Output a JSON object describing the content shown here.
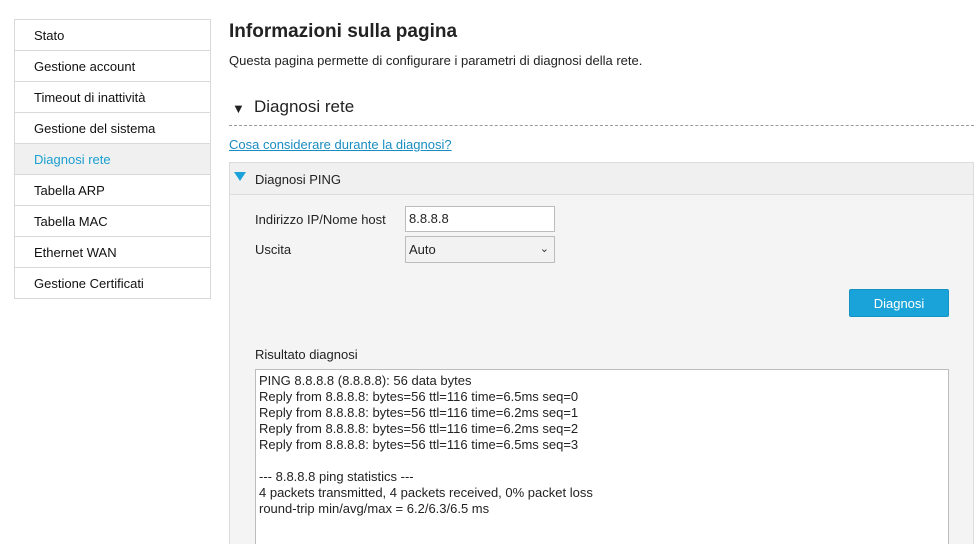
{
  "sidebar": {
    "items": [
      {
        "label": "Stato"
      },
      {
        "label": "Gestione account"
      },
      {
        "label": "Timeout di inattività"
      },
      {
        "label": "Gestione del sistema"
      },
      {
        "label": "Diagnosi rete"
      },
      {
        "label": "Tabella ARP"
      },
      {
        "label": "Tabella MAC"
      },
      {
        "label": "Ethernet WAN"
      },
      {
        "label": "Gestione Certificati"
      }
    ],
    "active_index": 4
  },
  "main": {
    "title": "Informazioni sulla pagina",
    "description": "Questa pagina permette di configurare i parametri di diagnosi della rete.",
    "section_title": "Diagnosi rete",
    "help_link": "Cosa considerare durante la diagnosi?",
    "panel": {
      "title": "Diagnosi PING",
      "ip_label": "Indirizzo IP/Nome host",
      "ip_value": "8.8.8.8",
      "output_label": "Uscita",
      "output_value": "Auto",
      "button_label": "Diagnosi",
      "result_label": "Risultato diagnosi",
      "result_text": "PING 8.8.8.8 (8.8.8.8): 56 data bytes\nReply from 8.8.8.8: bytes=56 ttl=116 time=6.5ms seq=0\nReply from 8.8.8.8: bytes=56 ttl=116 time=6.2ms seq=1\nReply from 8.8.8.8: bytes=56 ttl=116 time=6.2ms seq=2\nReply from 8.8.8.8: bytes=56 ttl=116 time=6.5ms seq=3\n\n--- 8.8.8.8 ping statistics ---\n4 packets transmitted, 4 packets received, 0% packet loss\nround-trip min/avg/max = 6.2/6.3/6.5 ms"
    }
  },
  "colors": {
    "accent": "#1aa3d8",
    "link": "#1a8cc2",
    "active_sidebar_text": "#1a9fd0"
  },
  "icons": {
    "section_toggle": "triangle-down-icon",
    "panel_toggle": "triangle-down-icon",
    "select_chevron": "chevron-down-icon"
  }
}
